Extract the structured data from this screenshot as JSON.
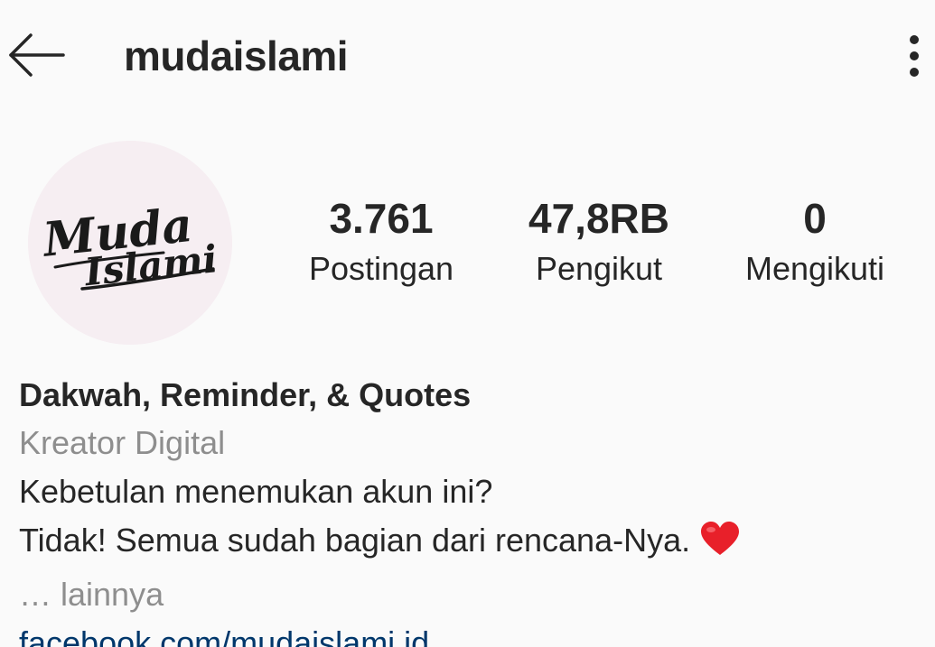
{
  "header": {
    "username": "mudaislami",
    "back_icon": "arrow-left-icon",
    "more_icon": "more-vertical-icon"
  },
  "profile": {
    "avatar_text_line1": "Muda",
    "avatar_text_line2": "Islami",
    "stats": [
      {
        "value": "3.761",
        "label": "Postingan"
      },
      {
        "value": "47,8RB",
        "label": "Pengikut"
      },
      {
        "value": "0",
        "label": "Mengikuti"
      }
    ]
  },
  "bio": {
    "name": "Dakwah, Reminder, & Quotes",
    "category": "Kreator Digital",
    "line1": "Kebetulan menemukan akun ini?",
    "line2": "Tidak! Semua sudah bagian dari rencana-Nya.",
    "line2_emoji": "heart-icon",
    "more": "… lainnya",
    "link": "facebook.com/mudaislami.id"
  },
  "colors": {
    "background": "#fafafa",
    "text": "#262626",
    "secondary": "#8e8e8e",
    "link": "#00376b",
    "heart": "#e8202a",
    "avatar_bg": "#f6eef2"
  }
}
